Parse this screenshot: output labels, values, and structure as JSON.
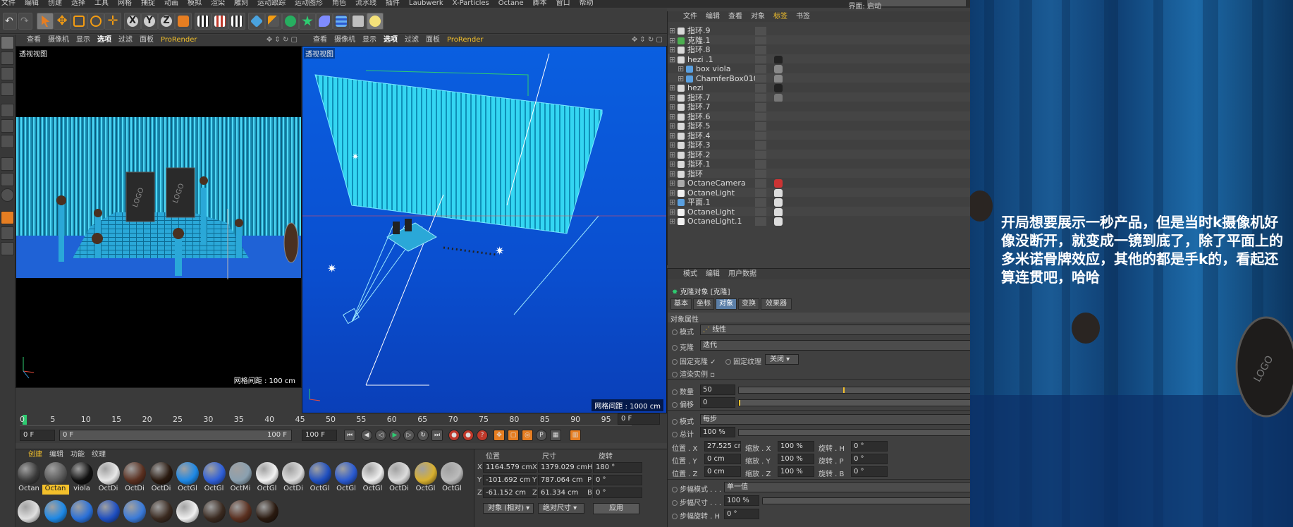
{
  "menubar": {
    "items": [
      "文件",
      "编辑",
      "创建",
      "选择",
      "工具",
      "网格",
      "捕捉",
      "动画",
      "模拟",
      "渲染",
      "雕刻",
      "运动跟踪",
      "运动图形",
      "角色",
      "流水线",
      "插件",
      "Laubwerk",
      "X-Particles",
      "Octane",
      "脚本",
      "窗口",
      "帮助"
    ],
    "layout_label": "界面:",
    "layout_value": "启动"
  },
  "toolbar": {
    "axis_x": "X",
    "axis_y": "Y",
    "axis_z": "Z"
  },
  "viewport_left": {
    "menu": [
      "查看",
      "摄像机",
      "显示",
      "选项",
      "过滤",
      "面板"
    ],
    "active": "选项",
    "prorender": "ProRender",
    "label": "透视视图",
    "grid": "网格间距 : 100 cm",
    "logo_text": "LOGO"
  },
  "viewport_right": {
    "menu": [
      "查看",
      "摄像机",
      "显示",
      "选项",
      "过滤",
      "面板"
    ],
    "active": "选项",
    "prorender": "ProRender",
    "label": "透视视图",
    "grid": "网格间距 : 1000 cm"
  },
  "timeline": {
    "ticks": [
      "0",
      "5",
      "10",
      "15",
      "20",
      "25",
      "30",
      "35",
      "40",
      "45",
      "50",
      "55",
      "60",
      "65",
      "70",
      "75",
      "80",
      "85",
      "90",
      "95",
      "10("
    ],
    "current_frame": "0 F",
    "start": "0 F",
    "range_start": "0 F",
    "range_end": "100 F",
    "end": "100 F"
  },
  "materials": {
    "menu": [
      "创建",
      "编辑",
      "功能",
      "纹理"
    ],
    "row1": [
      {
        "name": "Octan",
        "color": "#3a3a3a"
      },
      {
        "name": "Octan",
        "color": "#5a5a5a",
        "selected": true
      },
      {
        "name": "viola",
        "color": "#111111"
      },
      {
        "name": "OctDi",
        "color": "#e8e8e8"
      },
      {
        "name": "OctDi",
        "color": "#5a3020"
      },
      {
        "name": "OctDi",
        "color": "#2a1a10"
      },
      {
        "name": "OctGl",
        "color": "#1e88e5"
      },
      {
        "name": "OctGl",
        "color": "#2f5fd8"
      },
      {
        "name": "OctMi",
        "color": "#8aa0b0"
      },
      {
        "name": "OctGl",
        "color": "#f2f2f2"
      },
      {
        "name": "OctDi",
        "color": "#dddddd"
      },
      {
        "name": "OctGl",
        "color": "#1f4fc0"
      },
      {
        "name": "OctGl",
        "color": "#2a5ad0"
      },
      {
        "name": "OctGl",
        "color": "#eeeeee"
      },
      {
        "name": "OctDi",
        "color": "#dcdcdc"
      },
      {
        "name": "OctGl",
        "color": "#d8b030"
      },
      {
        "name": "OctGl",
        "color": "#bbbbbb"
      }
    ],
    "row2_colors": [
      "#e0e0e0",
      "#1e88e5",
      "#2a70d8",
      "#1f4fc0",
      "#3a7ad8",
      "#3a2a20",
      "#f0f0f0",
      "#3a2a20",
      "#5a3020",
      "#2a1a10"
    ]
  },
  "coords": {
    "headers": {
      "pos": "位置",
      "size": "尺寸",
      "rot": "旋转"
    },
    "rows": [
      {
        "axis": "X",
        "pos": "1164.579 cm",
        "size_axis": "X",
        "size": "1379.029 cm",
        "rot_axis": "H",
        "rot": "180 °"
      },
      {
        "axis": "Y",
        "pos": "-101.692 cm",
        "size_axis": "Y",
        "size": "787.064 cm",
        "rot_axis": "P",
        "rot": "0 °"
      },
      {
        "axis": "Z",
        "pos": "-61.152 cm",
        "size_axis": "Z",
        "size": "61.334 cm",
        "rot_axis": "B",
        "rot": "0 °"
      }
    ],
    "mode1": "对象 (相对)",
    "mode2": "绝对尺寸",
    "apply": "应用"
  },
  "object_manager": {
    "menu": [
      "文件",
      "编辑",
      "查看",
      "对象",
      "标签",
      "书签"
    ],
    "active": "标签",
    "rows": [
      {
        "name": "指环.9",
        "indent": 0,
        "icon": "#d9d9d9",
        "tag": ""
      },
      {
        "name": "克隆.1",
        "indent": 0,
        "icon": "#4caf50",
        "tag": ""
      },
      {
        "name": "指环.8",
        "indent": 0,
        "icon": "#d9d9d9",
        "tag": ""
      },
      {
        "name": "hezi .1",
        "indent": 0,
        "icon": "#d9d9d9",
        "tag": "#222"
      },
      {
        "name": "box viola",
        "indent": 1,
        "icon": "#5aa0e0",
        "tag": "#888"
      },
      {
        "name": "ChamferBox010",
        "indent": 1,
        "icon": "#5aa0e0",
        "tag": "#888"
      },
      {
        "name": "hezi",
        "indent": 0,
        "icon": "#d9d9d9",
        "tag": "#222"
      },
      {
        "name": "指环.7",
        "indent": 0,
        "icon": "#d9d9d9",
        "tag": "#777"
      },
      {
        "name": "指环.7",
        "indent": 0,
        "icon": "#d9d9d9",
        "tag": ""
      },
      {
        "name": "指环.6",
        "indent": 0,
        "icon": "#d9d9d9",
        "tag": ""
      },
      {
        "name": "指环.5",
        "indent": 0,
        "icon": "#d9d9d9",
        "tag": ""
      },
      {
        "name": "指环.4",
        "indent": 0,
        "icon": "#d9d9d9",
        "tag": ""
      },
      {
        "name": "指环.3",
        "indent": 0,
        "icon": "#d9d9d9",
        "tag": ""
      },
      {
        "name": "指环.2",
        "indent": 0,
        "icon": "#d9d9d9",
        "tag": ""
      },
      {
        "name": "指环.1",
        "indent": 0,
        "icon": "#d9d9d9",
        "tag": ""
      },
      {
        "name": "指环",
        "indent": 0,
        "icon": "#d9d9d9",
        "tag": ""
      },
      {
        "name": "OctaneCamera",
        "indent": 0,
        "icon": "#aaaaaa",
        "tag": "#c33"
      },
      {
        "name": "OctaneLight",
        "indent": 0,
        "icon": "#f0f0f0",
        "tag": "#ddd"
      },
      {
        "name": "平面.1",
        "indent": 0,
        "icon": "#5aa0e0",
        "tag": "#ddd"
      },
      {
        "name": "OctaneLight",
        "indent": 0,
        "icon": "#f0f0f0",
        "tag": "#ddd"
      },
      {
        "name": "OctaneLight.1",
        "indent": 0,
        "icon": "#f0f0f0",
        "tag": "#ddd"
      }
    ]
  },
  "attributes": {
    "menu": [
      "模式",
      "编辑",
      "用户数据"
    ],
    "title": "克隆对象 [克隆]",
    "tabs": [
      "基本",
      "坐标",
      "对象",
      "变换",
      "效果器"
    ],
    "active_tab": "对象",
    "section": "对象属性",
    "mode_label": "模式",
    "mode_value": "线性",
    "clone_label": "克隆",
    "clone_value": "迭代",
    "fix_clone": "固定克隆",
    "fix_texture": "固定纹理",
    "fix_texture_value": "关闭",
    "render_instance": "渲染实例",
    "count_label": "数量",
    "count_value": "50",
    "offset_label": "偏移",
    "offset_value": "0",
    "mode2_label": "模式",
    "mode2_value": "每步",
    "total_label": "总计",
    "total_value": "100 %",
    "transform_rows": [
      {
        "pl": "位置 . X",
        "pv": "27.525 cm",
        "sl": "缩放 . X",
        "sv": "100 %",
        "rl": "旋转 . H",
        "rv": "0 °"
      },
      {
        "pl": "位置 . Y",
        "pv": "0 cm",
        "sl": "缩放 . Y",
        "sv": "100 %",
        "rl": "旋转 . P",
        "rv": "0 °"
      },
      {
        "pl": "位置 . Z",
        "pv": "0 cm",
        "sl": "缩放 . Z",
        "sv": "100 %",
        "rl": "旋转 . B",
        "rv": "0 °"
      }
    ],
    "step_mode_label": "步幅模式 . . . .",
    "step_mode_value": "单一值",
    "step_size_label": "步幅尺寸 . . .",
    "step_size_value": "100 %",
    "step_rot_label": "步幅旋转 . H",
    "step_rot_value": "0 °"
  },
  "video": {
    "caption": "开局想要展示一秒产品，但是当时k摄像机好像没断开，就变成一镜到底了，除了平面上的多米诺骨牌效应，其他的都是手k的，看起还算连贯吧，哈哈",
    "logo_text": "LOGO"
  }
}
